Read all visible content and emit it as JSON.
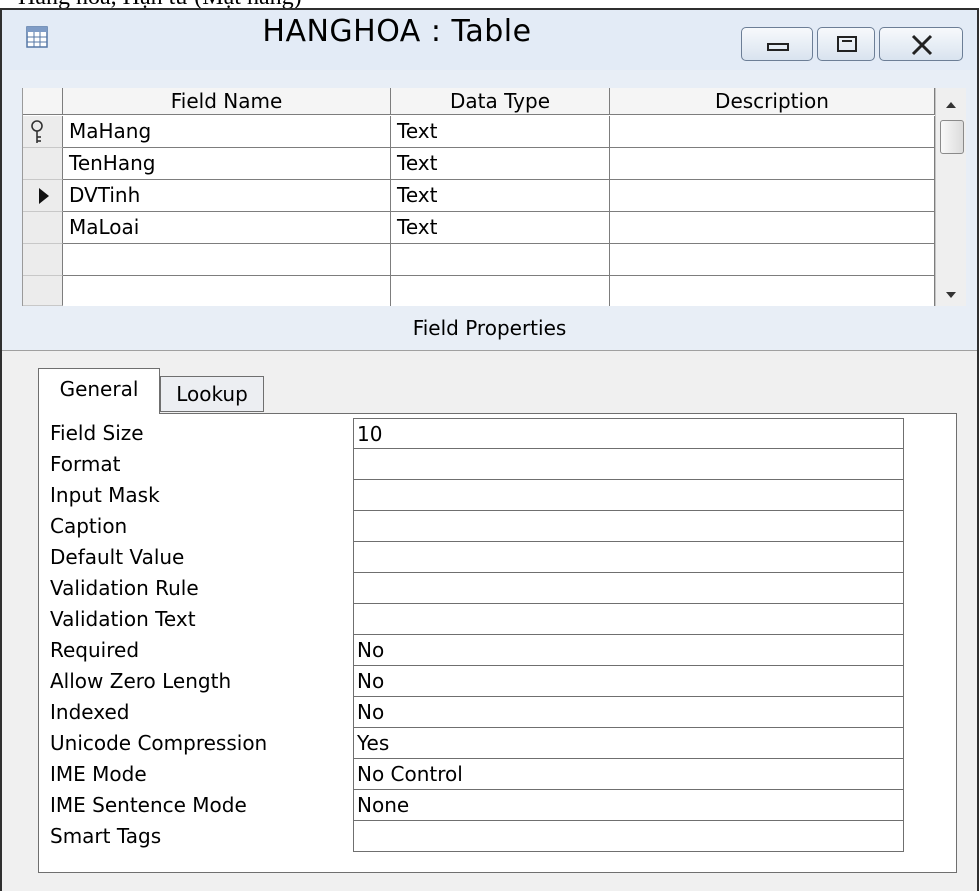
{
  "caption": "Hàng hóa, Hạn từ (Mặt hàng)",
  "window": {
    "title": "HANGHOA : Table"
  },
  "grid": {
    "columns": [
      "Field Name",
      "Data Type",
      "Description"
    ],
    "rows": [
      {
        "field": "MaHang",
        "type": "Text",
        "description": ""
      },
      {
        "field": "TenHang",
        "type": "Text",
        "description": ""
      },
      {
        "field": "DVTinh",
        "type": "Text",
        "description": ""
      },
      {
        "field": "MaLoai",
        "type": "Text",
        "description": ""
      },
      {
        "field": "",
        "type": "",
        "description": ""
      },
      {
        "field": "",
        "type": "",
        "description": ""
      }
    ],
    "primary_key_row": 0,
    "current_row": 2
  },
  "field_properties_label": "Field Properties",
  "tabs": [
    "General",
    "Lookup"
  ],
  "active_tab": "General",
  "properties": [
    {
      "label": "Field Size",
      "value": "10"
    },
    {
      "label": "Format",
      "value": ""
    },
    {
      "label": "Input Mask",
      "value": ""
    },
    {
      "label": "Caption",
      "value": ""
    },
    {
      "label": "Default Value",
      "value": ""
    },
    {
      "label": "Validation Rule",
      "value": ""
    },
    {
      "label": "Validation Text",
      "value": ""
    },
    {
      "label": "Required",
      "value": "No"
    },
    {
      "label": "Allow Zero Length",
      "value": "No"
    },
    {
      "label": "Indexed",
      "value": "No"
    },
    {
      "label": "Unicode Compression",
      "value": "Yes"
    },
    {
      "label": "IME Mode",
      "value": "No Control"
    },
    {
      "label": "IME Sentence Mode",
      "value": "None"
    },
    {
      "label": "Smart Tags",
      "value": ""
    }
  ],
  "icons": {
    "table": "table-icon",
    "minimize": "minimize-icon",
    "maximize": "maximize-icon",
    "close": "close-icon",
    "primary_key": "key-icon",
    "current_row": "row-pointer-icon"
  },
  "colors": {
    "titlebar": "#e3ebf6",
    "window_border": "#2f2f2f",
    "grid_line": "#7d7d7d",
    "panel": "#ffffff"
  }
}
